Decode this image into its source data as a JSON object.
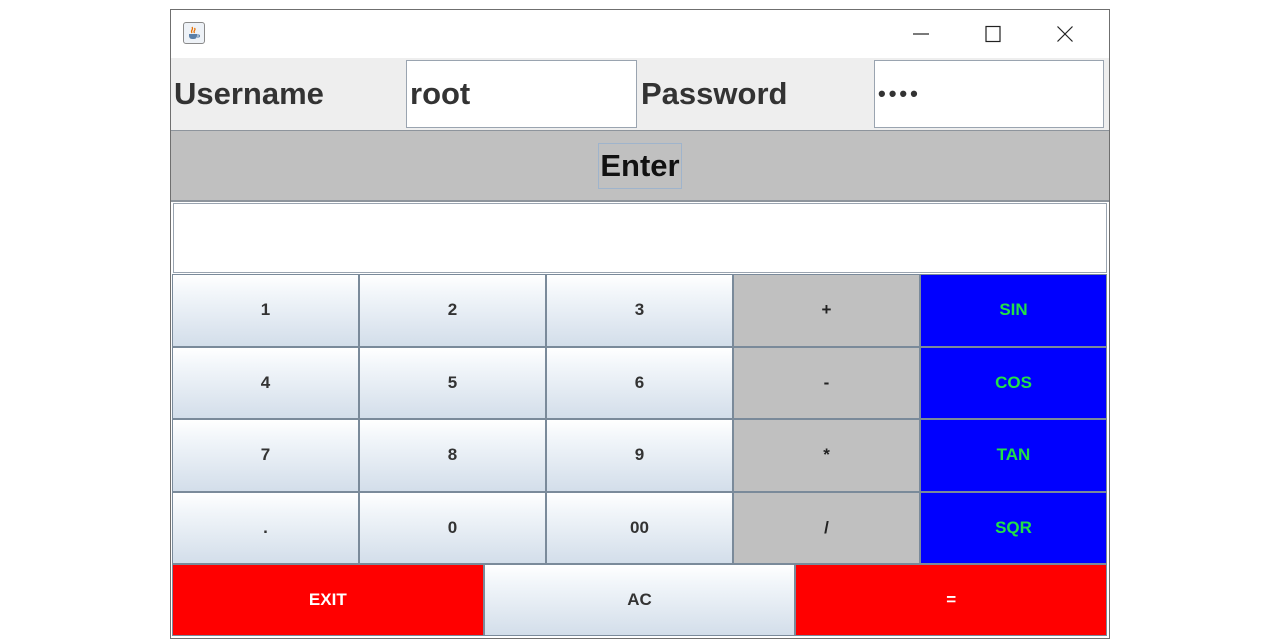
{
  "window": {
    "title": "",
    "controls": {
      "minimize": "minimize",
      "maximize": "maximize",
      "close": "close"
    }
  },
  "login": {
    "username_label": "Username",
    "username_value": "root",
    "password_label": "Password",
    "password_value": "••••"
  },
  "enter_label": "Enter",
  "display_value": "",
  "keypad": {
    "rows": [
      [
        "1",
        "2",
        "3",
        "+",
        "SIN"
      ],
      [
        "4",
        "5",
        "6",
        "-",
        "COS"
      ],
      [
        "7",
        "8",
        "9",
        "*",
        "TAN"
      ],
      [
        ".",
        "0",
        "00",
        "/",
        "SQR"
      ]
    ],
    "bottom": {
      "exit": "EXIT",
      "clear": "AC",
      "equals": "="
    }
  },
  "colors": {
    "function_keys_bg": "#0000ff",
    "function_keys_text": "#22e046",
    "operator_keys_bg": "#c0c0c0",
    "exit_equals_bg": "#ff0000",
    "enter_bar_bg": "#c0c0c0"
  },
  "icons": {
    "app": "java-coffee-cup-icon",
    "minimize": "minimize-icon",
    "maximize": "maximize-icon",
    "close": "close-icon"
  }
}
